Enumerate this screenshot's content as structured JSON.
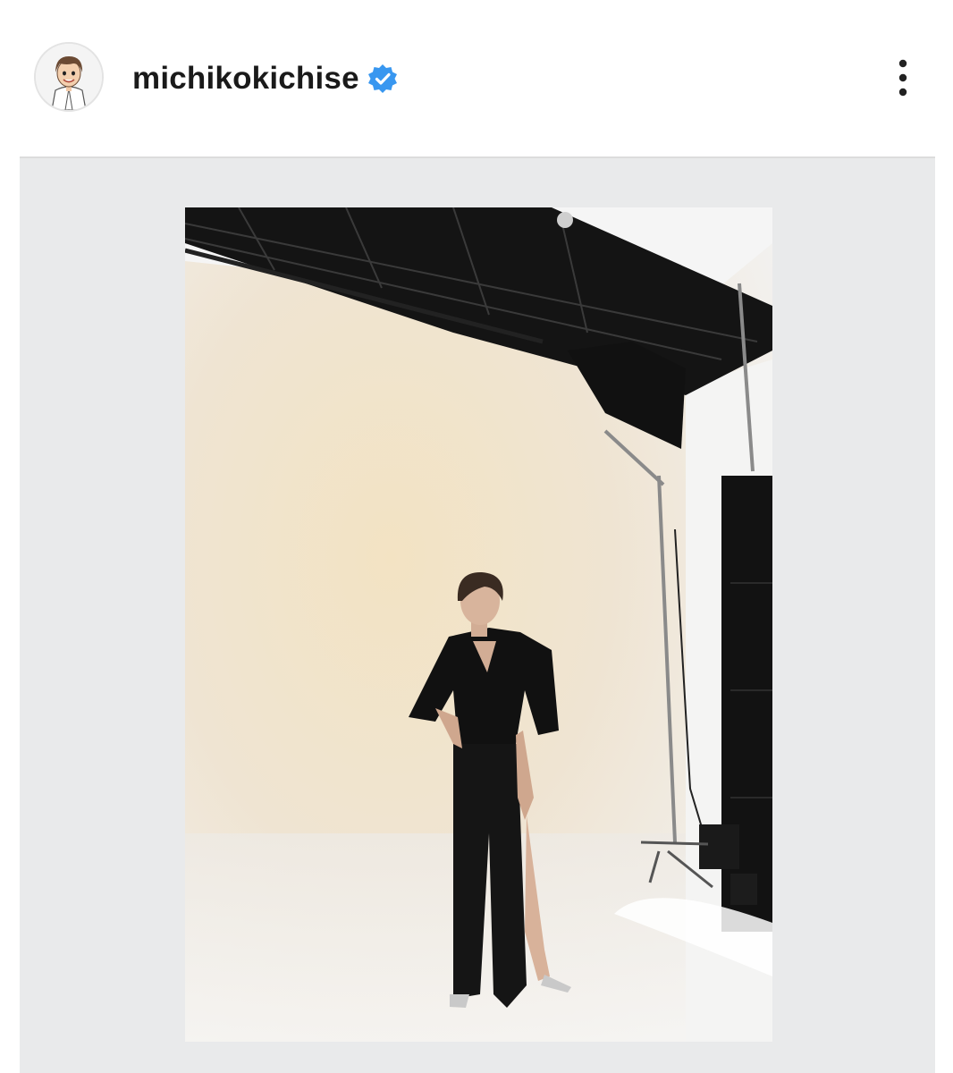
{
  "post_header": {
    "username": "michikokichise",
    "verified_icon": "verified-badge-icon",
    "more_icon": "vertical-ellipsis-icon",
    "avatar_icon": "cartoon-avatar"
  },
  "post_media": {
    "description_icon": "studio-photo"
  },
  "colors": {
    "verified": "#3897f0",
    "post_background": "#e9eaeb",
    "text": "#1a1a1a"
  }
}
